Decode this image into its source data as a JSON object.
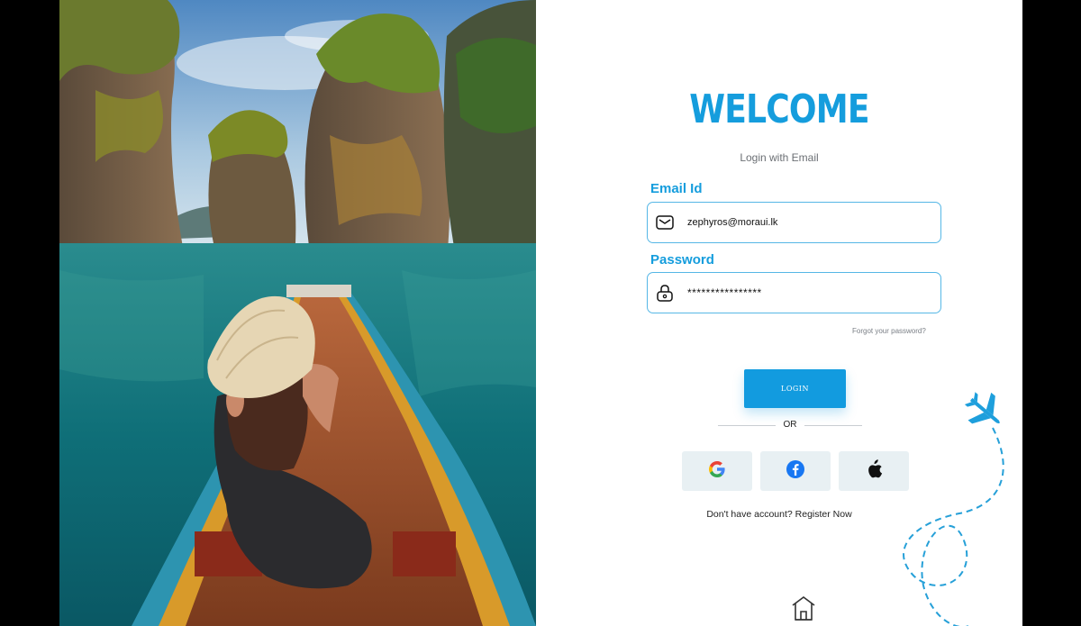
{
  "login": {
    "title": "WELCOME",
    "subtitle": "Login with Email",
    "email": {
      "label": "Email Id",
      "value": "zephyros@moraui.lk",
      "icon": "mail-icon"
    },
    "password": {
      "label": "Password",
      "value": "****************",
      "icon": "lock-icon"
    },
    "forgot_label": "Forgot your password?",
    "login_label": "LOGIN",
    "or_label": "OR",
    "social": [
      {
        "name": "google",
        "icon": "google-icon"
      },
      {
        "name": "facebook",
        "icon": "facebook-icon"
      },
      {
        "name": "apple",
        "icon": "apple-icon"
      }
    ],
    "register_prompt": "Don't have account?",
    "register_link": "Register Now"
  },
  "colors": {
    "accent": "#159ddd",
    "button": "#129bdf",
    "social_bg": "#e8f0f3",
    "facebook": "#1877f2"
  },
  "icons": {
    "airplane": "airplane-icon",
    "home": "home-icon"
  }
}
